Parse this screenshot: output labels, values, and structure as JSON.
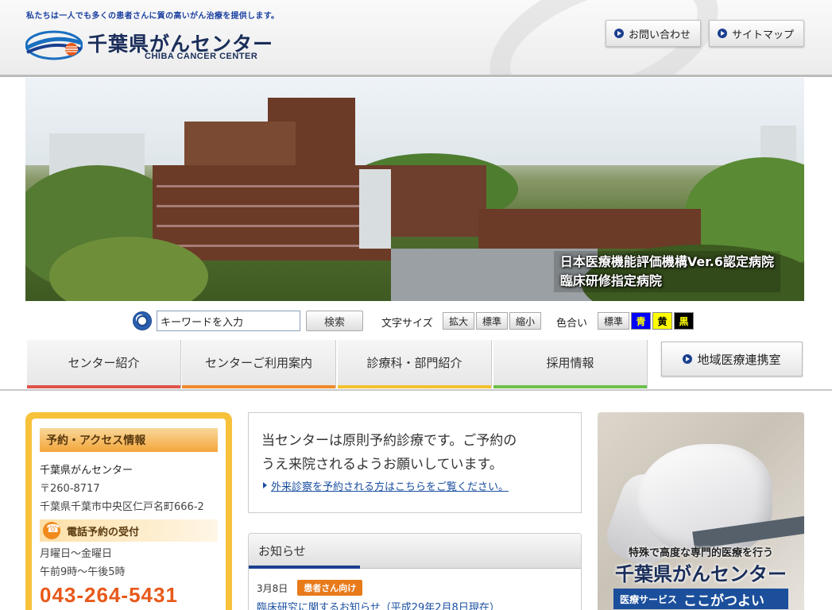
{
  "header": {
    "tagline": "私たちは一人でも多くの患者さんに質の高いがん治療を提供します。",
    "logo_jp": "千葉県がんセンター",
    "logo_en": "CHIBA CANCER CENTER",
    "contact_label": "お問い合わせ",
    "sitemap_label": "サイトマップ"
  },
  "hero": {
    "caption_line1": "日本医療機能評価機構Ver.6認定病院",
    "caption_line2": "臨床研修指定病院"
  },
  "search": {
    "placeholder": "キーワードを入力",
    "value": "キーワードを入力",
    "button_label": "検索"
  },
  "text_size": {
    "label": "文字サイズ",
    "options": [
      "拡大",
      "標準",
      "縮小"
    ]
  },
  "color_scheme": {
    "label": "色合い",
    "options": [
      {
        "label": "標準",
        "bg": "#eeeeee",
        "fg": "#222222"
      },
      {
        "label": "青",
        "bg": "#0000ff",
        "fg": "#ffff00"
      },
      {
        "label": "黄",
        "bg": "#ffff00",
        "fg": "#000000"
      },
      {
        "label": "黒",
        "bg": "#000000",
        "fg": "#ffff00"
      }
    ]
  },
  "nav": {
    "tabs": [
      {
        "label": "センター紹介",
        "color": "#e0524a"
      },
      {
        "label": "センターご利用案内",
        "color": "#f08a2a"
      },
      {
        "label": "診療科・部門紹介",
        "color": "#f2c22e"
      },
      {
        "label": "採用情報",
        "color": "#6cc04a"
      }
    ],
    "regional_label": "地域医療連携室"
  },
  "access": {
    "heading": "予約・アクセス情報",
    "name": "千葉県がんセンター",
    "postal": "〒260-8717",
    "address": "千葉県千葉市中央区仁戸名町666-2",
    "phone_heading": "電話予約の受付",
    "hours_days": "月曜日～金曜日",
    "hours_time": "午前9時～午後5時",
    "phone": "043-264-5431"
  },
  "notice": {
    "line1": "当センターは原則予約診療です。ご予約の",
    "line2": "うえ来院されるようお願いしています。",
    "link": "外来診察を予約される方はこちらをご覧ください。"
  },
  "news": {
    "heading": "お知らせ",
    "items": [
      {
        "date": "3月8日",
        "badge": "患者さん向け",
        "title": "臨床研究に関するお知らせ（平成29年2月8日現在）"
      }
    ]
  },
  "banner": {
    "line1": "特殊で高度な専門的医療を行う",
    "line2": "千葉県がんセンター",
    "strip_small": "医療サービス",
    "strip_big": "ここがつよい"
  },
  "colors": {
    "brand_navy": "#1b3f8f",
    "access_panel": "#f7c23a",
    "phone_orange": "#e8591a",
    "badge_orange": "#e87a1a"
  }
}
